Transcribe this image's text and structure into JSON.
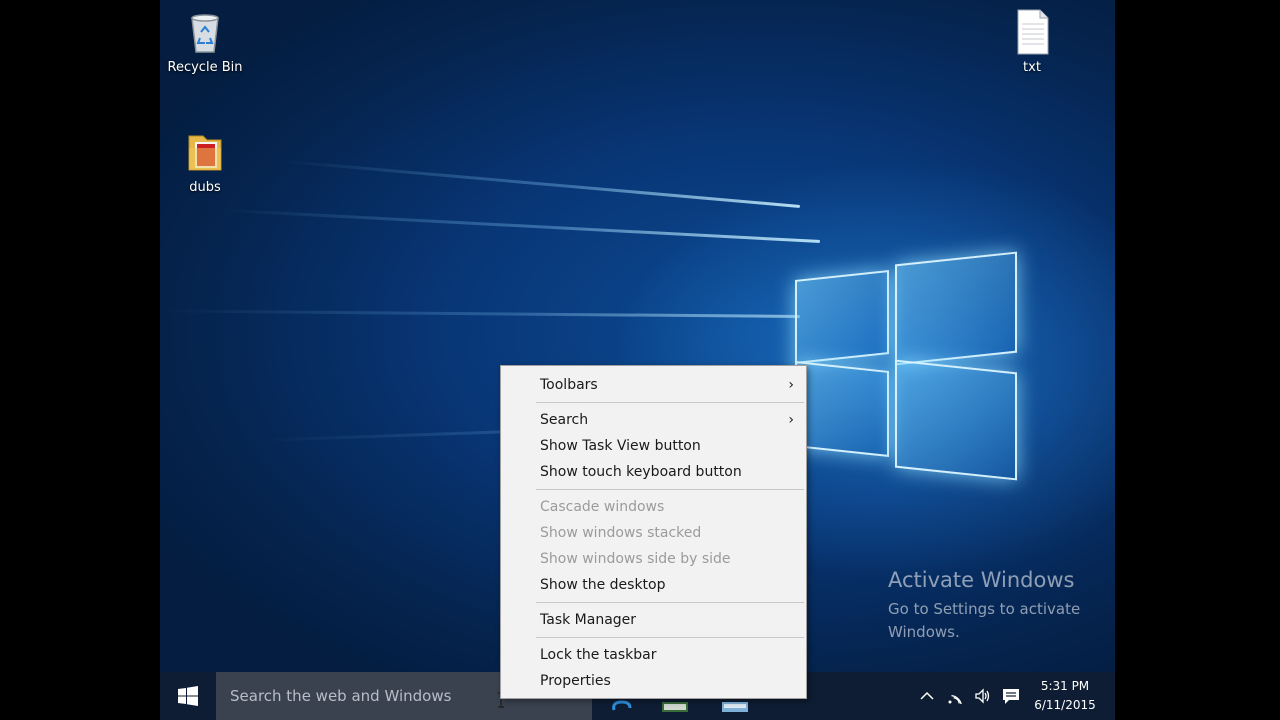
{
  "desktop": {
    "icons": [
      {
        "label": "Recycle Bin",
        "icon": "recycle-bin-icon"
      },
      {
        "label": "dubs",
        "icon": "folder-icon"
      },
      {
        "label": "txt",
        "icon": "text-file-icon"
      }
    ],
    "watermark": {
      "title": "Activate Windows",
      "subtitle": "Go to Settings to activate Windows."
    }
  },
  "taskbar": {
    "start_icon": "windows-logo-icon",
    "search_placeholder": "Search the web and Windows",
    "tray_icons": [
      "chevron-up-icon",
      "wifi-icon",
      "volume-icon",
      "notifications-icon"
    ],
    "clock": {
      "time": "5:31 PM",
      "date": "6/11/2015"
    }
  },
  "context_menu": {
    "items": [
      {
        "label": "Toolbars",
        "submenu": true
      },
      {
        "label": "Search",
        "submenu": true
      },
      {
        "label": "Show Task View button"
      },
      {
        "label": "Show touch keyboard button"
      },
      {
        "label": "Cascade windows",
        "disabled": true
      },
      {
        "label": "Show windows stacked",
        "disabled": true
      },
      {
        "label": "Show windows side by side",
        "disabled": true
      },
      {
        "label": "Show the desktop"
      },
      {
        "label": "Task Manager"
      },
      {
        "label": "Lock the taskbar"
      },
      {
        "label": "Properties"
      }
    ],
    "submenu_arrow": "›"
  },
  "colors": {
    "taskbar": "#0e1d33",
    "search_box": "#3a4250",
    "desktop_accent": "#1e8ee0"
  }
}
